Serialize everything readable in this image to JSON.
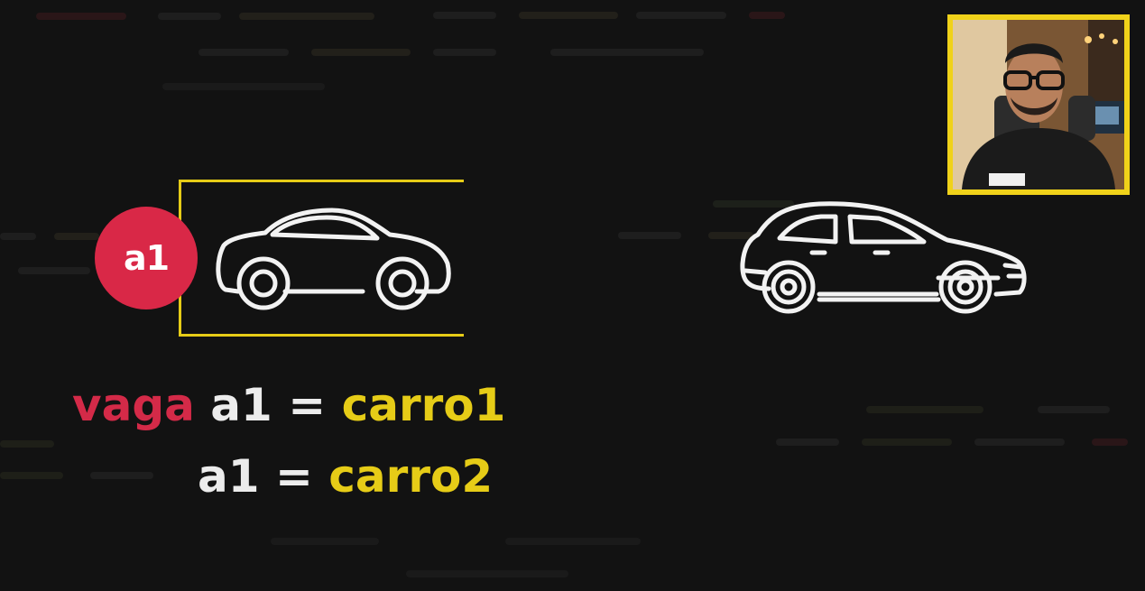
{
  "badge": {
    "label": "a1"
  },
  "code": {
    "line1": {
      "keyword": "vaga",
      "variable": "a1",
      "operator": "=",
      "value": "carro1"
    },
    "line2": {
      "variable": "a1",
      "operator": "=",
      "value": "carro2"
    }
  },
  "icons": {
    "parked_car": "sedan-car-icon",
    "incoming_car": "hatchback-car-icon"
  },
  "colors": {
    "background": "#121212",
    "accent_yellow": "#e6cc17",
    "accent_red": "#d92847",
    "text_light": "#ececec"
  }
}
